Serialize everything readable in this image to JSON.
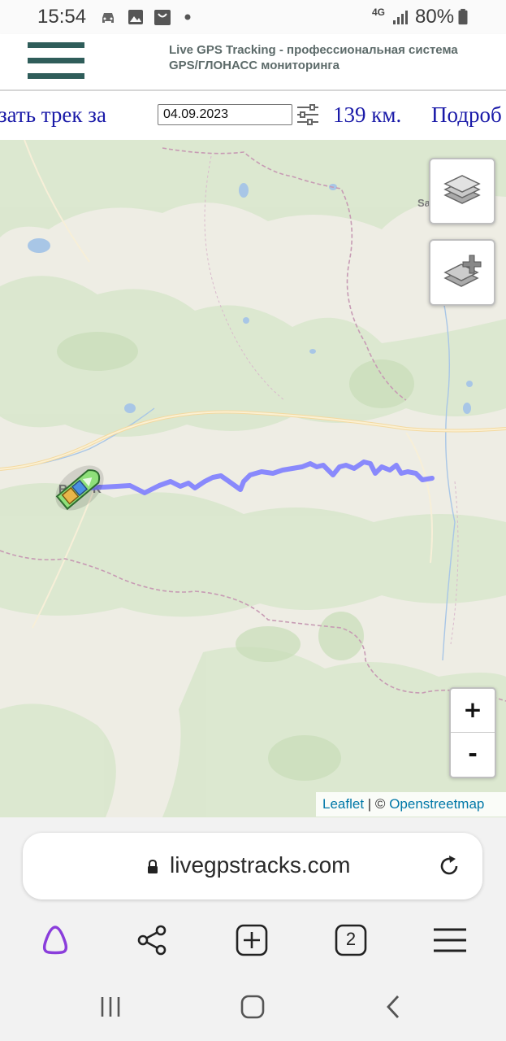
{
  "status_bar": {
    "time": "15:54",
    "network": "4G",
    "battery": "80%"
  },
  "header": {
    "title_line1": "Live GPS Tracking - профессиональная система",
    "title_line2": "GPS/ГЛОНАСС мониторинга",
    "menu_icon": "hamburger-icon",
    "accent_color": "#2f5d5a"
  },
  "toolbar": {
    "track_label": "азать трек за",
    "date_value": "04.09.2023",
    "distance": "139 км.",
    "details_link": "Подроб",
    "text_color": "#1a1aa8"
  },
  "map": {
    "track_color": "#7b7bff",
    "vehicle_icon": "boat-icon",
    "place_labels": [
      "Sa",
      "R",
      "K"
    ],
    "controls": {
      "layers_icon": "layers-icon",
      "add_layer_icon": "add-layer-icon",
      "zoom_in": "+",
      "zoom_out": "-"
    },
    "attribution": {
      "leaflet": "Leaflet",
      "separator": "| ©",
      "osm": "Openstreetmap"
    }
  },
  "browser": {
    "url": "livegpstracks.com",
    "tab_count": "2",
    "bottom_icons": [
      "alice-icon",
      "share-icon",
      "new-tab-icon",
      "tabs-icon",
      "menu-icon"
    ]
  }
}
